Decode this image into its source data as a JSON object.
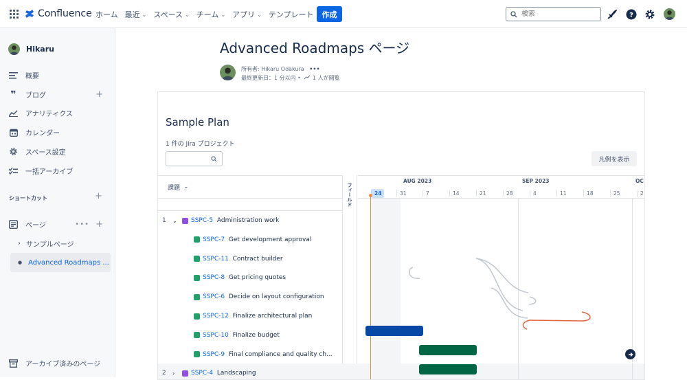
{
  "nav": {
    "logo": "Confluence",
    "items": [
      "ホーム",
      "最近",
      "スペース",
      "チーム",
      "アプリ",
      "テンプレート"
    ],
    "items_with_chevron": [
      false,
      true,
      true,
      true,
      true,
      false
    ],
    "create": "作成",
    "search_placeholder": "検索"
  },
  "sidebar": {
    "user": "Hikaru",
    "items": [
      "概要",
      "ブログ",
      "アナリティクス",
      "カレンダー",
      "スペース設定",
      "一括アーカイブ"
    ],
    "shortcuts": "ショートカット",
    "pages": "ページ",
    "sample_page": "サンプルページ",
    "active_page": "Advanced Roadmaps ...",
    "archived": "アーカイブ済みのページ"
  },
  "page": {
    "title": "Advanced Roadmaps ページ",
    "owner": "所有者: Hikaru Odakura",
    "updated": "最終更新日：1 分以内 •",
    "views": "1 人が閲覧"
  },
  "plan": {
    "title": "Sample Plan",
    "subtitle": "1 件の Jira プロジェクト",
    "legend_btn": "凡例を表示",
    "column_header": "課題",
    "fields_label": "フィールド",
    "months": [
      "AUG 2023",
      "SEP 2023",
      "OC"
    ],
    "days": [
      "24",
      "31",
      "7",
      "14",
      "21",
      "28",
      "4",
      "11",
      "18",
      "25",
      "2"
    ],
    "rows": [
      {
        "num": "1",
        "expand": "⌄",
        "key": "SSPC-5",
        "summary": "Administration work",
        "type": "epic"
      },
      {
        "num": "",
        "expand": "",
        "key": "SSPC-7",
        "summary": "Get development approval",
        "type": "story"
      },
      {
        "num": "",
        "expand": "",
        "key": "SSPC-11",
        "summary": "Contract builder",
        "type": "story"
      },
      {
        "num": "",
        "expand": "",
        "key": "SSPC-8",
        "summary": "Get pricing quotes",
        "type": "story"
      },
      {
        "num": "",
        "expand": "",
        "key": "SSPC-6",
        "summary": "Decide on layout configuration",
        "type": "story"
      },
      {
        "num": "",
        "expand": "",
        "key": "SSPC-12",
        "summary": "Finalize architectural plan",
        "type": "story"
      },
      {
        "num": "",
        "expand": "",
        "key": "SSPC-10",
        "summary": "Finalize budget",
        "type": "story"
      },
      {
        "num": "",
        "expand": "",
        "key": "SSPC-9",
        "summary": "Final compliance and quality ch...",
        "type": "story"
      },
      {
        "num": "2",
        "expand": "›",
        "key": "SSPC-4",
        "summary": "Landscaping",
        "type": "epic"
      }
    ]
  },
  "colors": {
    "brand": "#0c66e4",
    "bar_blue": "#0747a6",
    "bar_green": "#006644",
    "bar_slate": "#42526e",
    "epic_icon": "#904ee2",
    "story_icon": "#22a06b",
    "today": "#f38a3f"
  }
}
